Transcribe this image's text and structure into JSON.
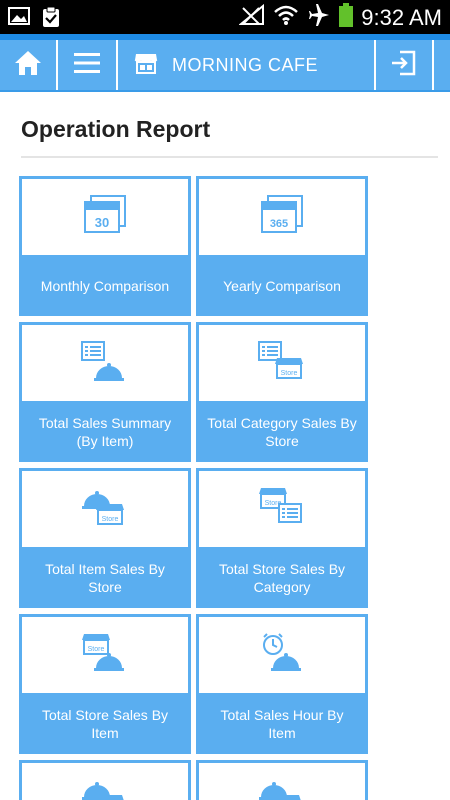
{
  "status_bar": {
    "time": "9:32 AM"
  },
  "app_bar": {
    "title": "MORNING CAFE"
  },
  "page": {
    "title": "Operation Report"
  },
  "tiles": [
    {
      "label": "Monthly Comparison",
      "icon": "calendar-30-icon",
      "icon_text": "30"
    },
    {
      "label": "Yearly Comparison",
      "icon": "calendar-365-icon",
      "icon_text": "365"
    },
    {
      "label": "Total Sales Summary (By Item)",
      "icon": "list-dish-icon"
    },
    {
      "label": "Total Category Sales By Store",
      "icon": "list-store-icon"
    },
    {
      "label": "Total Item Sales By Store",
      "icon": "dish-store-icon"
    },
    {
      "label": "Total Store Sales By Category",
      "icon": "store-list-icon"
    },
    {
      "label": "Total Store Sales By Item",
      "icon": "store-dish-icon"
    },
    {
      "label": "Total Sales Hour By Item",
      "icon": "clock-dish-icon"
    }
  ],
  "icon_badge_text": "Store",
  "colors": {
    "accent": "#5aaef0",
    "accent_dark": "#1f8ce6",
    "status_bar": "#000000"
  }
}
